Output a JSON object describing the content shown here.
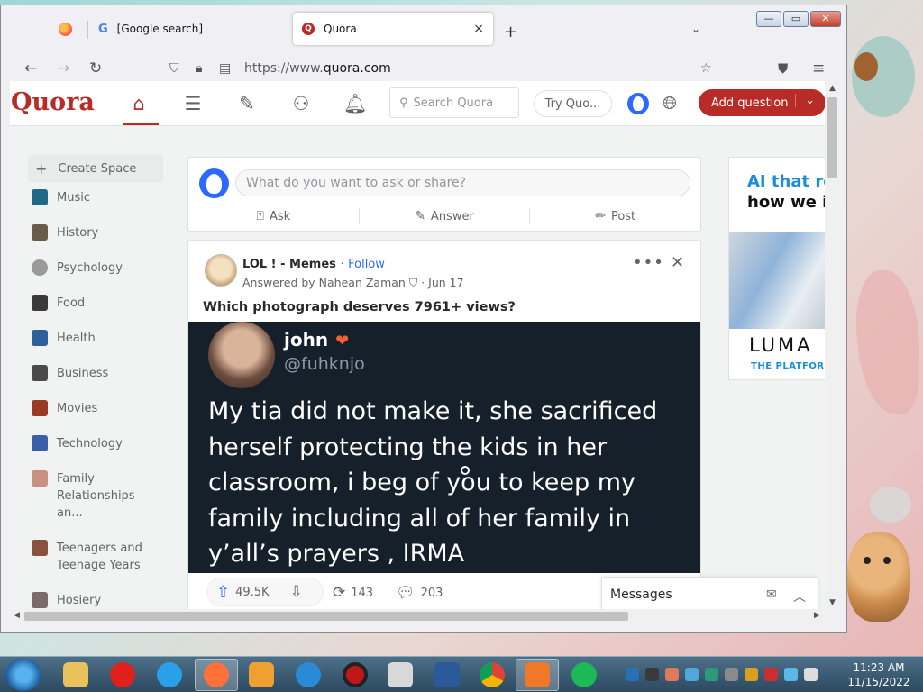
{
  "browser": {
    "tabs": [
      {
        "title": "",
        "icon": "firefox-icon"
      },
      {
        "title": "[Google search]",
        "icon": "google-icon",
        "close": ""
      },
      {
        "title": "Quora",
        "icon": "quora-icon",
        "close": "×"
      }
    ],
    "new_tab": "+",
    "tab_menu": "⌄",
    "url_prefix": "https://www.",
    "url_domain": "quora.com",
    "window_controls": {
      "minimize": "—",
      "maximize": "▭",
      "close": "✕"
    }
  },
  "quora": {
    "logo": "Quora",
    "search_placeholder": "Search Quora",
    "try_button": "Try Quo...",
    "add_question": "Add question",
    "accent": "#b92b27",
    "sidebar": [
      {
        "label": "Create Space"
      },
      {
        "label": "Music",
        "color": "#1e6a84"
      },
      {
        "label": "History",
        "color": "#6a5a48"
      },
      {
        "label": "Psychology",
        "color": "#9a9a9a"
      },
      {
        "label": "Food",
        "color": "#3a3a3a"
      },
      {
        "label": "Health",
        "color": "#2d5f9a"
      },
      {
        "label": "Business",
        "color": "#4a4a4a"
      },
      {
        "label": "Movies",
        "color": "#9a3a22"
      },
      {
        "label": "Technology",
        "color": "#3a5ea8"
      },
      {
        "label": "Family Relationships an...",
        "color": "#c89080"
      },
      {
        "label": "Teenagers and Teenage Years",
        "color": "#8a5040"
      },
      {
        "label": "Hosiery",
        "color": "#7a6a6a"
      }
    ],
    "ask": {
      "placeholder": "What do you want to ask or share?",
      "ask": "Ask",
      "answer": "Answer",
      "post": "Post"
    },
    "post": {
      "source": "LOL ! - Memes",
      "separator": "·",
      "follow": "Follow",
      "answered_by": "Answered by Nahean Zaman",
      "date": "· Jun 17",
      "question": "Which photograph deserves 7961+ views?",
      "tweet": {
        "name": "john",
        "handle": "@fuhknjo",
        "text": "My tia did not make it, she sacrificed herself protecting the kids in her classroom, i beg of you to keep my family including all of her family in y’all’s prayers , IRMA"
      },
      "upvotes": "49.5K",
      "shares": "143",
      "comments": "203"
    },
    "ad": {
      "line1": "AI that re",
      "line2": "how we i",
      "brand": "LUMA",
      "tagline": "THE PLATFOR"
    },
    "messages": "Messages"
  },
  "taskbar": {
    "time": "11:23 AM",
    "date": "11/15/2022"
  }
}
